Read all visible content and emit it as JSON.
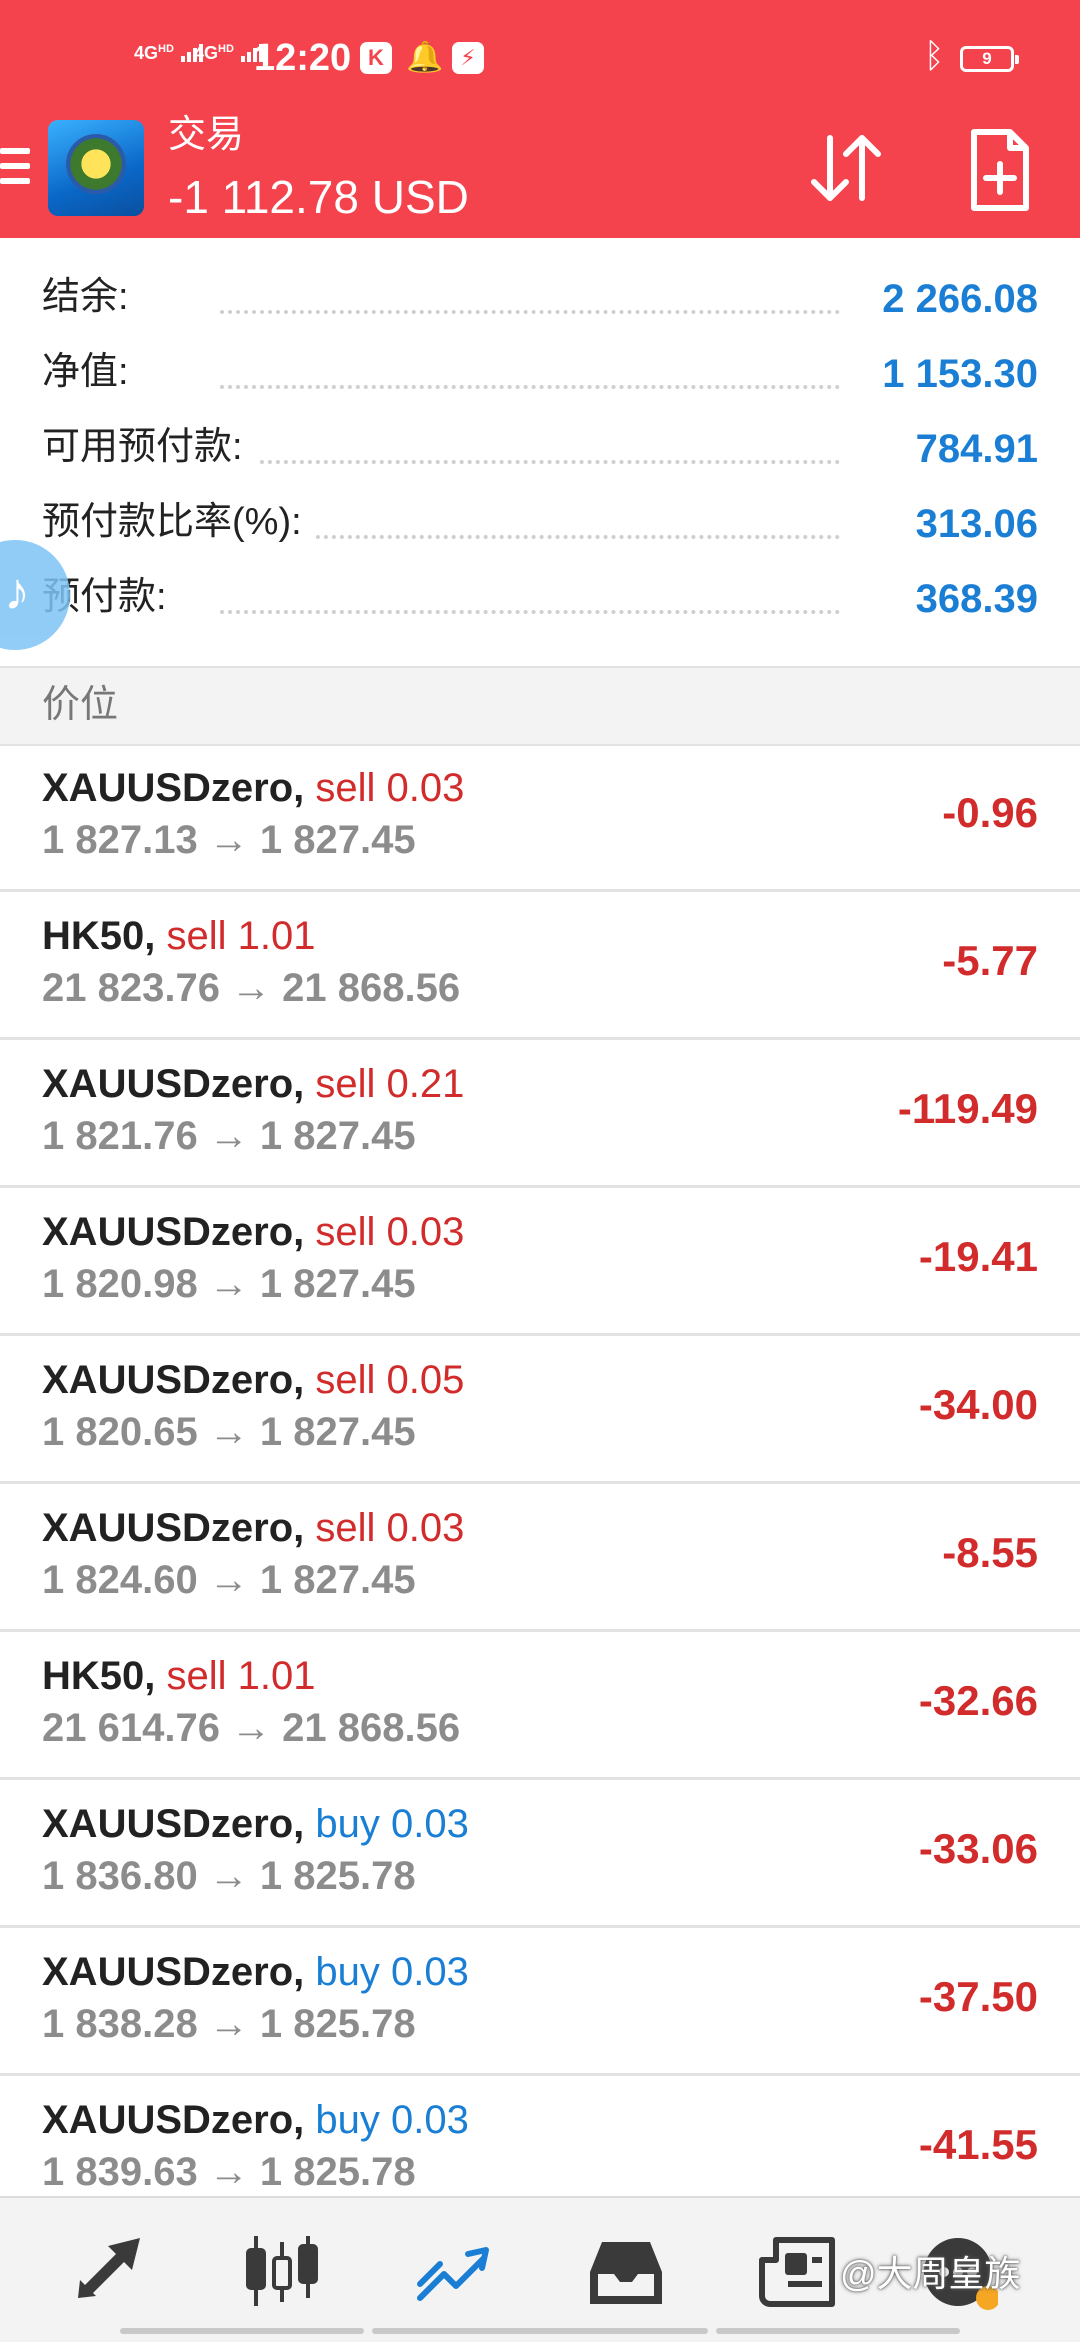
{
  "status_bar": {
    "net1": "4G",
    "net1_sup": "HD",
    "net2": "4G",
    "net2_sup": "HD",
    "time": "12:20",
    "battery": "9"
  },
  "app_bar": {
    "title": "交易",
    "balance": "-1 112.78 USD"
  },
  "summary": [
    {
      "label": "结余:",
      "value": "2 266.08"
    },
    {
      "label": "净值:",
      "value": "1 153.30"
    },
    {
      "label": "可用预付款:",
      "value": "784.91"
    },
    {
      "label": "预付款比率(%):",
      "value": "313.06"
    },
    {
      "label": "预付款:",
      "value": "368.39"
    }
  ],
  "section": {
    "title": "价位"
  },
  "positions": [
    {
      "symbol": "XAUUSDzero,",
      "side": "sell 0.03",
      "dir": "sell",
      "prices": "1 827.13 → 1 827.45",
      "profit": "-0.96"
    },
    {
      "symbol": "HK50,",
      "side": "sell 1.01",
      "dir": "sell",
      "prices": "21 823.76 → 21 868.56",
      "profit": "-5.77"
    },
    {
      "symbol": "XAUUSDzero,",
      "side": "sell 0.21",
      "dir": "sell",
      "prices": "1 821.76 → 1 827.45",
      "profit": "-119.49"
    },
    {
      "symbol": "XAUUSDzero,",
      "side": "sell 0.03",
      "dir": "sell",
      "prices": "1 820.98 → 1 827.45",
      "profit": "-19.41"
    },
    {
      "symbol": "XAUUSDzero,",
      "side": "sell 0.05",
      "dir": "sell",
      "prices": "1 820.65 → 1 827.45",
      "profit": "-34.00"
    },
    {
      "symbol": "XAUUSDzero,",
      "side": "sell 0.03",
      "dir": "sell",
      "prices": "1 824.60 → 1 827.45",
      "profit": "-8.55"
    },
    {
      "symbol": "HK50,",
      "side": "sell 1.01",
      "dir": "sell",
      "prices": "21 614.76 → 21 868.56",
      "profit": "-32.66"
    },
    {
      "symbol": "XAUUSDzero,",
      "side": "buy 0.03",
      "dir": "buy",
      "prices": "1 836.80 → 1 825.78",
      "profit": "-33.06"
    },
    {
      "symbol": "XAUUSDzero,",
      "side": "buy 0.03",
      "dir": "buy",
      "prices": "1 838.28 → 1 825.78",
      "profit": "-37.50"
    },
    {
      "symbol": "XAUUSDzero,",
      "side": "buy 0.03",
      "dir": "buy",
      "prices": "1 839.63 → 1 825.78",
      "profit": "-41.55"
    }
  ],
  "watermark": "@大周皇族",
  "colors": {
    "header": "#f4434d",
    "value_blue": "#1a7fd4",
    "loss_red": "#d22b2b",
    "nav_active": "#1a7fd4",
    "nav_inactive": "#3a3a3a"
  },
  "icons": {
    "bottom_nav": [
      "quotes-arrows-icon",
      "chart-candles-icon",
      "trade-trend-icon",
      "history-inbox-icon",
      "news-icon",
      "chat-icon"
    ]
  }
}
